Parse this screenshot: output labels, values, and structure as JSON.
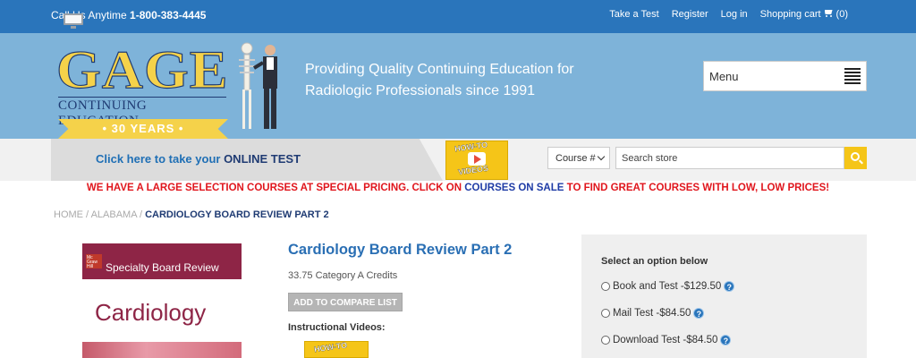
{
  "topbar": {
    "call_label": "Call Us Anytime",
    "phone": "1-800-383-4445",
    "links": [
      "Take a Test",
      "Register",
      "Log in",
      "Shopping cart"
    ],
    "cart_count": "(0)"
  },
  "header": {
    "logo_text": "GAGE",
    "logo_subtext": "CONTINUING EDUCATION",
    "logo_ribbon": "• 30 YEARS •",
    "tagline_line1": "Providing Quality Continuing Education for",
    "tagline_line2": "Radiologic Professionals since 1991",
    "menu_label": "Menu"
  },
  "graybar": {
    "online_prefix": "Click here to take your ",
    "online_strong": "ONLINE TEST",
    "howto_top": "HOW-TO",
    "howto_bottom": "VIDEOS",
    "course_select": "Course #",
    "search_placeholder": "Search store"
  },
  "promo": {
    "part1": "WE HAVE A LARGE SELECTION COURSES AT SPECIAL PRICING. CLICK ON ",
    "link": "COURSES ON SALE",
    "part2": " TO FIND GREAT COURSES WITH LOW, LOW PRICES!"
  },
  "breadcrumb": {
    "home": "HOME",
    "sep": " / ",
    "state": "ALABAMA",
    "current": "CARDIOLOGY BOARD REVIEW PART 2"
  },
  "book": {
    "publisher": "Mc Graw Hill",
    "series": "Specialty Board Review",
    "title": "Cardiology"
  },
  "product": {
    "title": "Cardiology Board Review Part 2",
    "credits": "33.75 Category A Credits",
    "compare_label": "ADD TO COMPARE LIST",
    "videos_label": "Instructional Videos:"
  },
  "options": {
    "heading": "Select an option below",
    "items": [
      "Book and Test -$129.50",
      "Mail Test -$84.50",
      "Download Test -$84.50"
    ]
  },
  "colors": {
    "topbar": "#2a75bb",
    "header": "#7eb3d9",
    "promo_red": "#e0161d",
    "title_blue": "#2a6fb4",
    "accent_yellow": "#f5c518"
  }
}
